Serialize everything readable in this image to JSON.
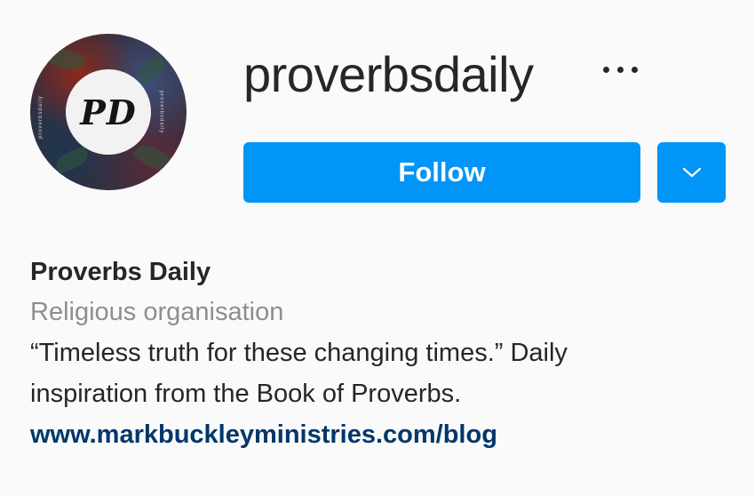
{
  "profile": {
    "username": "proverbsdaily",
    "avatar_monogram": "PD",
    "avatar_side_text": "proverbsdaily"
  },
  "actions": {
    "follow_label": "Follow",
    "more_icon": "more-horizontal-icon",
    "dropdown_icon": "chevron-down-icon",
    "accent_color": "#0095f6"
  },
  "bio": {
    "full_name": "Proverbs Daily",
    "category": "Religious organisation",
    "line1": "“Timeless truth for these changing times.” Daily",
    "line2": "inspiration from the Book of Proverbs.",
    "link": "www.markbuckleyministries.com/blog",
    "link_color": "#00376b"
  }
}
